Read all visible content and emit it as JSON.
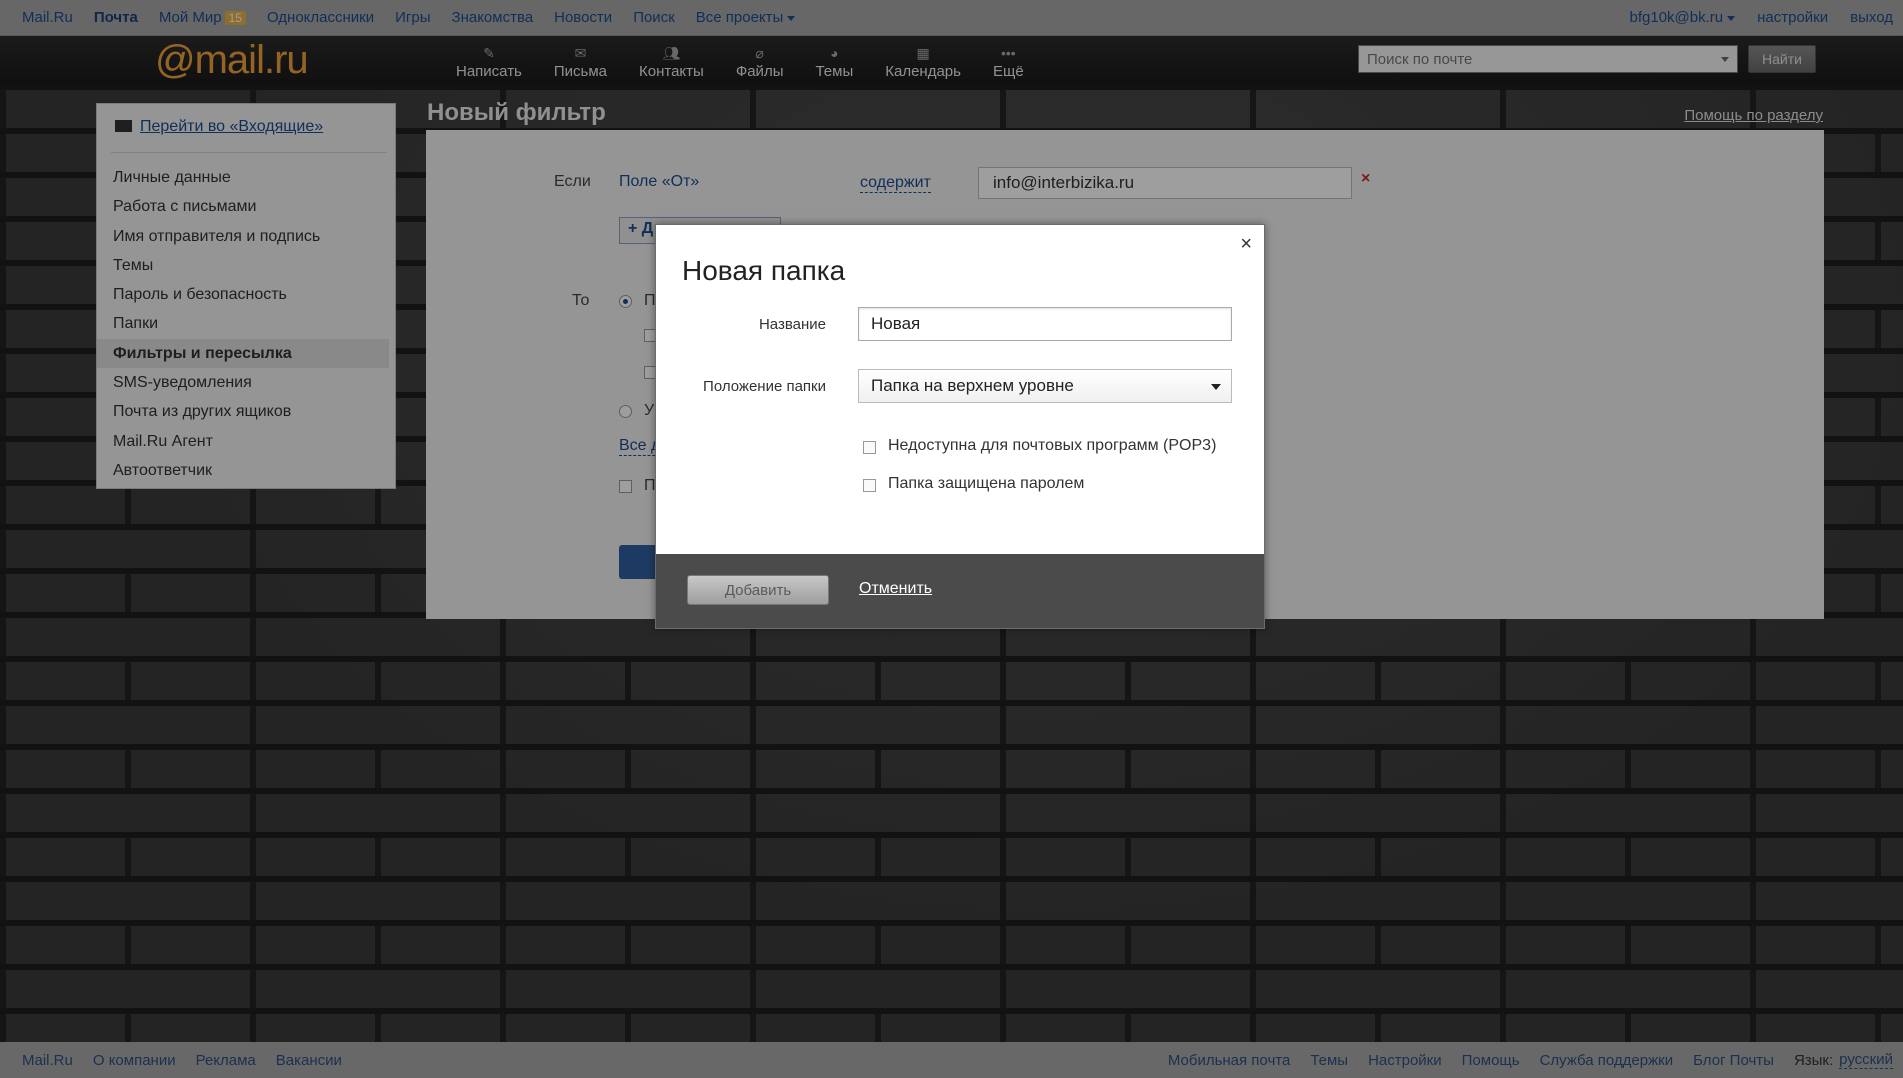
{
  "portal": {
    "links": [
      "Mail.Ru",
      "Почта",
      "Мой Мир",
      "Одноклассники",
      "Игры",
      "Знакомства",
      "Новости",
      "Поиск",
      "Все проекты"
    ],
    "moymir_badge": "15",
    "user": "bfg10k@bk.ru",
    "settings": "настройки",
    "logout": "выход"
  },
  "header": {
    "logo_at": "@",
    "logo_text": "mail.ru",
    "nav": [
      {
        "label": "Написать",
        "icon": "pencil-icon"
      },
      {
        "label": "Письма",
        "icon": "envelope-icon"
      },
      {
        "label": "Контакты",
        "icon": "contacts-icon"
      },
      {
        "label": "Файлы",
        "icon": "paperclip-icon"
      },
      {
        "label": "Темы",
        "icon": "palette-icon"
      },
      {
        "label": "Календарь",
        "icon": "calendar-icon"
      },
      {
        "label": "Ещё",
        "icon": "more-dots-icon"
      }
    ],
    "search_placeholder": "Поиск по почте",
    "search_button": "Найти"
  },
  "sidebar": {
    "inbox_link": "Перейти во «Входящие»",
    "items": [
      "Личные данные",
      "Работа с письмами",
      "Имя отправителя и подпись",
      "Темы",
      "Пароль и безопасность",
      "Папки",
      "Фильтры и пересылка",
      "SMS-уведомления",
      "Почта из других ящиков",
      "Mail.Ru Агент",
      "Автоответчик"
    ],
    "active_index": 6
  },
  "main": {
    "title": "Новый фильтр",
    "help_link": "Помощь по разделу",
    "if_label": "Если",
    "field_link": "Поле «От»",
    "contains_link": "содержит",
    "condition_value": "info@interbizika.ru",
    "delete_mark": "×",
    "add_condition_stub": "+ Д",
    "then_label": "То",
    "radio1_stub": "П",
    "radio2_stub": "У",
    "all_link_stub": "Все д",
    "checkbox_stub": "П"
  },
  "modal": {
    "title": "Новая папка",
    "close": "×",
    "name_label": "Название",
    "name_value": "Новая",
    "position_label": "Положение папки",
    "position_value": "Папка на верхнем уровне",
    "checkbox_pop3": "Недоступна для почтовых программ (POP3)",
    "checkbox_password": "Папка защищена паролем",
    "add_button": "Добавить",
    "cancel_link": "Отменить"
  },
  "footer": {
    "left": [
      "Mail.Ru",
      "О компании",
      "Реклама",
      "Вакансии"
    ],
    "right": [
      "Мобильная почта",
      "Темы",
      "Настройки",
      "Помощь",
      "Служба поддержки",
      "Блог Почты"
    ],
    "lang_label": "Язык:",
    "lang_value": "русский"
  },
  "colors": {
    "accent_orange": "#f0a23a",
    "link_blue": "#1b4c8f",
    "modal_footer": "#4b4b4b",
    "delete_red": "#c0302a"
  }
}
